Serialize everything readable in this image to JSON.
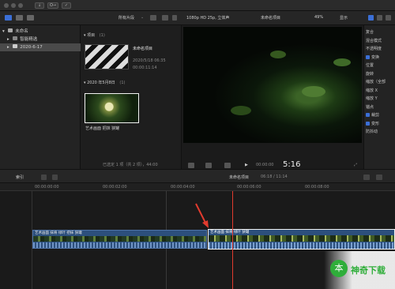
{
  "toolbar": {
    "filter_label": "所有片段",
    "format_label": "1080p HD 25p, 立体声",
    "project_title": "未命名项目",
    "zoom": "49%",
    "display_label": "显示"
  },
  "library": {
    "root": "未命名",
    "items": [
      {
        "label": "智能精选"
      },
      {
        "label": "2020-6-17"
      }
    ]
  },
  "browser": {
    "project_section": "项目",
    "project_count": "(1)",
    "project": {
      "name": "未命名项目",
      "date": "2020/5/18 06:35",
      "duration": "00:00:11:14"
    },
    "date_section": "2020 年5月8日",
    "date_count": "(1)",
    "clip_name": "艺术画面  把抹 狭罐",
    "status": "已选定 1 项（共 2 项），44:00"
  },
  "viewer": {
    "timecode": "5:16",
    "timecode_prefix": "00:00:00"
  },
  "inspector": {
    "items": [
      {
        "label": "复合",
        "checkbox": false
      },
      {
        "label": "混合模式",
        "checkbox": false
      },
      {
        "label": "不透明度",
        "checkbox": false
      },
      {
        "label": "变换",
        "checkbox": true
      },
      {
        "label": "位置",
        "checkbox": false
      },
      {
        "label": "旋转",
        "checkbox": false
      },
      {
        "label": "缩放（全部",
        "checkbox": false
      },
      {
        "label": "缩放 X",
        "checkbox": false
      },
      {
        "label": "缩放 Y",
        "checkbox": false
      },
      {
        "label": "锚点",
        "checkbox": false
      },
      {
        "label": "裁剪",
        "checkbox": true
      },
      {
        "label": "变形",
        "checkbox": true
      },
      {
        "label": "防抖动",
        "checkbox": false
      }
    ]
  },
  "timeline": {
    "index_label": "索引",
    "project_title": "未命名项目",
    "duration_text": "06:18 / 11:14",
    "ruler": [
      "00:00:00:00",
      "00:00:02:00",
      "00:00:04:00",
      "00:00:06:00",
      "00:00:08:00"
    ],
    "clip1_label": "艺术画面 抹将 绿叶 把抹 狭罐",
    "clip2_label": "艺术画面 抹将 绿叶 狭罐"
  },
  "watermark": {
    "text": "神奇下载",
    "symbol": "本"
  },
  "colors": {
    "accent": "#3b6fd6",
    "playhead": "#e23b2e",
    "clip_selected": "#f2f2f2",
    "watermark_green": "#2fae3a"
  }
}
